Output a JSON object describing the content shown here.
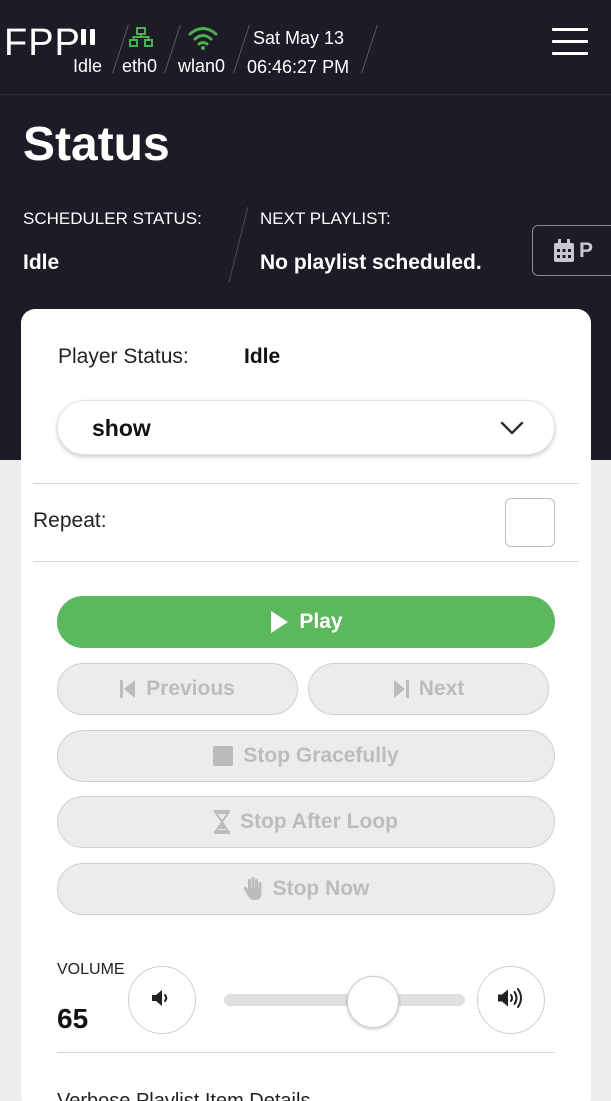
{
  "header": {
    "brand": "FPP",
    "status": "Idle",
    "eth": "eth0",
    "wlan": "wlan0",
    "date": "Sat May 13",
    "time": "06:46:27 PM",
    "eth_color": "#4caf50",
    "wifi_color": "#4caf50",
    "icons": [
      "pause-icon",
      "network-icon",
      "wifi-icon",
      "hamburger-menu-icon"
    ]
  },
  "status": {
    "title": "Status",
    "scheduler_label": "SCHEDULER STATUS:",
    "scheduler_value": "Idle",
    "next_label": "NEXT PLAYLIST:",
    "next_value": "No playlist scheduled.",
    "schedule_button_partial": "P"
  },
  "player": {
    "status_label": "Player Status:",
    "status_value": "Idle",
    "playlist_selected": "show",
    "repeat_label": "Repeat:",
    "repeat_checked": false,
    "buttons": {
      "play": "Play",
      "previous": "Previous",
      "next": "Next",
      "stop_gracefully": "Stop Gracefully",
      "stop_after_loop": "Stop After Loop",
      "stop_now": "Stop Now"
    },
    "play_color": "#5cb85c",
    "volume_label": "VOLUME",
    "volume_value": "65",
    "volume_level": 0.62,
    "trailing_text": "Verbose Playlist Item Details"
  }
}
